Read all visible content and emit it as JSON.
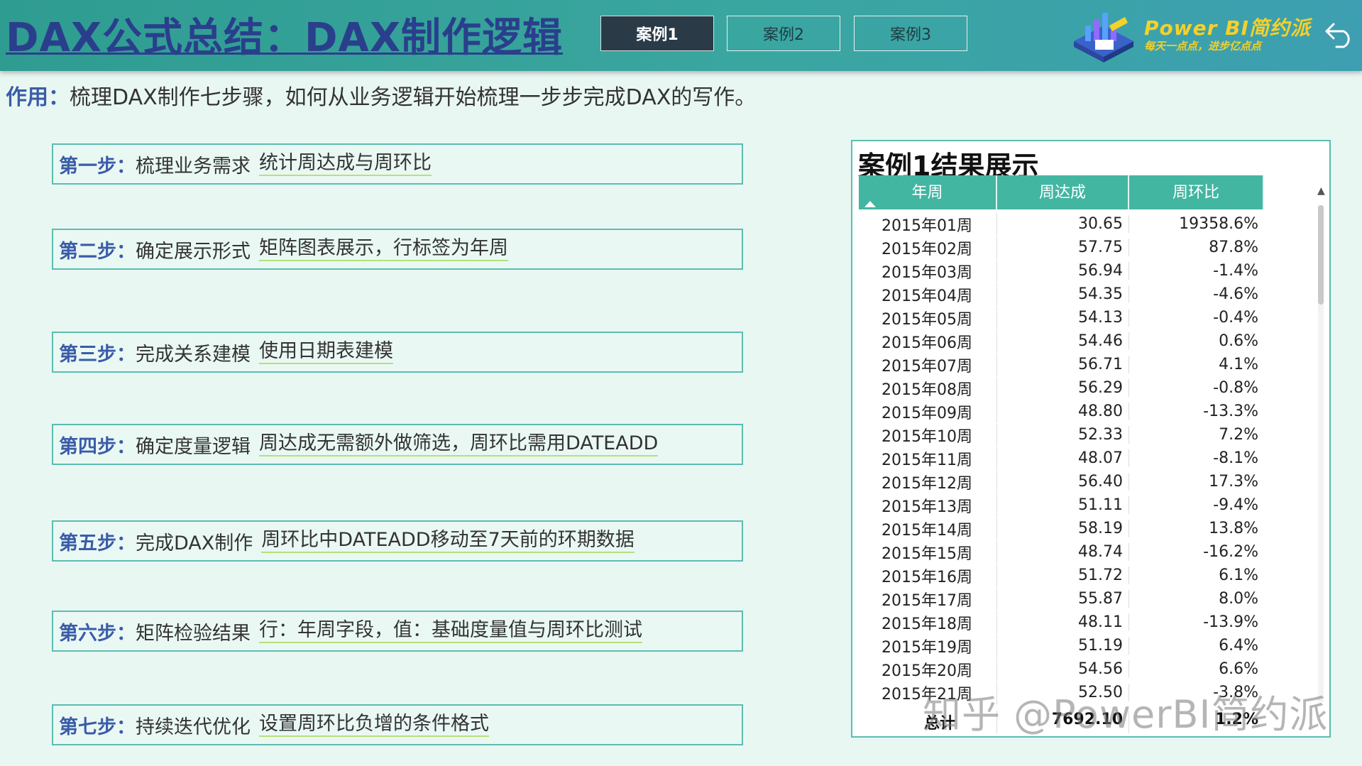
{
  "header": {
    "title": "DAX公式总结：DAX制作逻辑",
    "tabs": [
      {
        "label": "案例1",
        "active": true
      },
      {
        "label": "案例2",
        "active": false
      },
      {
        "label": "案例3",
        "active": false
      }
    ],
    "brand_title": "Power BI简约派",
    "brand_subtitle": "每天一点点，进步亿点点"
  },
  "purpose": {
    "label": "作用：",
    "text": "梳理DAX制作七步骤，如何从业务逻辑开始梳理一步步完成DAX的写作。"
  },
  "steps": [
    {
      "label": "第一步：",
      "title": "梳理业务需求",
      "desc": "统计周达成与周环比"
    },
    {
      "label": "第二步：",
      "title": "确定展示形式",
      "desc": "矩阵图表展示，行标签为年周"
    },
    {
      "label": "第三步：",
      "title": "完成关系建模",
      "desc": "使用日期表建模"
    },
    {
      "label": "第四步：",
      "title": "确定度量逻辑",
      "desc": "周达成无需额外做筛选，周环比需用DATEADD"
    },
    {
      "label": "第五步：",
      "title": "完成DAX制作",
      "desc": "周环比中DATEADD移动至7天前的环期数据"
    },
    {
      "label": "第六步：",
      "title": "矩阵检验结果",
      "desc": "行：年周字段，值：基础度量值与周环比测试"
    },
    {
      "label": "第七步：",
      "title": "持续迭代优化",
      "desc": "设置周环比负增的条件格式"
    }
  ],
  "result": {
    "title": "案例1结果展示",
    "columns": [
      "年周",
      "周达成",
      "周环比"
    ],
    "rows": [
      [
        "2015年01周",
        "30.65",
        "19358.6%"
      ],
      [
        "2015年02周",
        "57.75",
        "87.8%"
      ],
      [
        "2015年03周",
        "56.94",
        "-1.4%"
      ],
      [
        "2015年04周",
        "54.35",
        "-4.6%"
      ],
      [
        "2015年05周",
        "54.13",
        "-0.4%"
      ],
      [
        "2015年06周",
        "54.46",
        "0.6%"
      ],
      [
        "2015年07周",
        "56.71",
        "4.1%"
      ],
      [
        "2015年08周",
        "56.29",
        "-0.8%"
      ],
      [
        "2015年09周",
        "48.80",
        "-13.3%"
      ],
      [
        "2015年10周",
        "52.33",
        "7.2%"
      ],
      [
        "2015年11周",
        "48.07",
        "-8.1%"
      ],
      [
        "2015年12周",
        "56.40",
        "17.3%"
      ],
      [
        "2015年13周",
        "51.11",
        "-9.4%"
      ],
      [
        "2015年14周",
        "58.19",
        "13.8%"
      ],
      [
        "2015年15周",
        "48.74",
        "-16.2%"
      ],
      [
        "2015年16周",
        "51.72",
        "6.1%"
      ],
      [
        "2015年17周",
        "55.87",
        "8.0%"
      ],
      [
        "2015年18周",
        "48.11",
        "-13.9%"
      ],
      [
        "2015年19周",
        "51.19",
        "6.4%"
      ],
      [
        "2015年20周",
        "54.56",
        "6.6%"
      ],
      [
        "2015年21周",
        "52.50",
        "-3.8%"
      ]
    ],
    "total": {
      "label": "总计",
      "value": "7692.10",
      "ratio": "1.2%"
    }
  },
  "watermark": "知乎 @PowerBI简约派",
  "colors": {
    "header_bg": "#3aa6a0",
    "title": "#2a3f8c",
    "label_blue": "#3a5ca8",
    "table_header": "#43b6a2",
    "border": "#5bbdb0",
    "active_tab": "#2a3a47",
    "brand_yellow": "#f5d12a"
  }
}
